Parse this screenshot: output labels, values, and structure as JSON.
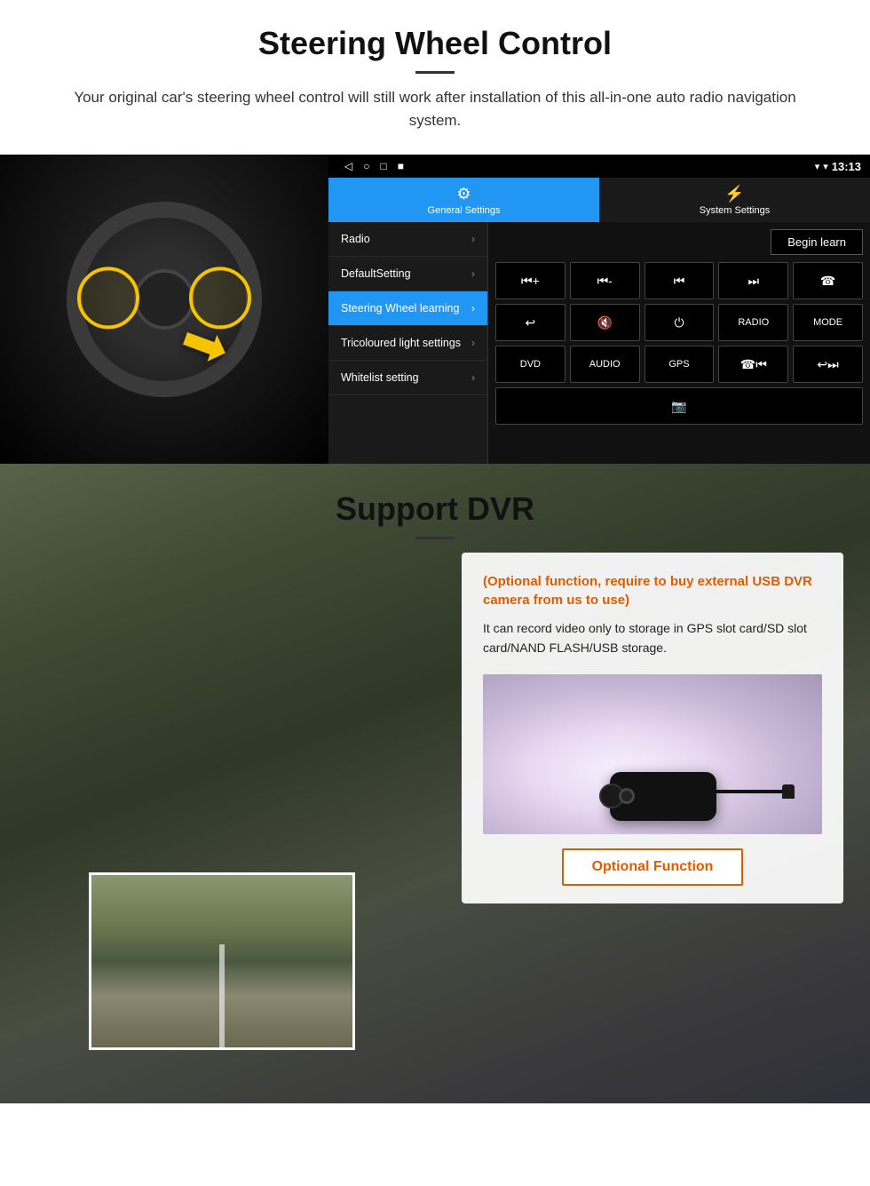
{
  "page": {
    "steering": {
      "title": "Steering Wheel Control",
      "subtitle": "Your original car's steering wheel control will still work after installation of this all-in-one auto radio navigation system.",
      "android_ui": {
        "status_bar": {
          "nav_icons": [
            "◁",
            "○",
            "□",
            "■"
          ],
          "signal_icon": "▾",
          "wifi_icon": "▾",
          "time": "13:13"
        },
        "tabs": [
          {
            "label": "General Settings",
            "icon": "⚙",
            "active": true
          },
          {
            "label": "System Settings",
            "icon": "⚡",
            "active": false
          }
        ],
        "menu_items": [
          {
            "label": "Radio",
            "active": false
          },
          {
            "label": "DefaultSetting",
            "active": false
          },
          {
            "label": "Steering Wheel learning",
            "active": true
          },
          {
            "label": "Tricoloured light settings",
            "active": false
          },
          {
            "label": "Whitelist setting",
            "active": false
          }
        ],
        "begin_learn_label": "Begin learn",
        "control_buttons": [
          [
            "⏮+",
            "⏮-",
            "⏮|",
            "|⏭",
            "☎"
          ],
          [
            "↩",
            "🔇x",
            "⏻",
            "RADIO",
            "MODE"
          ],
          [
            "DVD",
            "AUDIO",
            "GPS",
            "☎⏮|",
            "↩⏭"
          ]
        ],
        "extra_button": "📷"
      }
    },
    "dvr": {
      "title": "Support DVR",
      "optional_text": "(Optional function, require to buy external USB DVR camera from us to use)",
      "description": "It can record video only to storage in GPS slot card/SD slot card/NAND FLASH/USB storage.",
      "optional_button_label": "Optional Function"
    }
  }
}
